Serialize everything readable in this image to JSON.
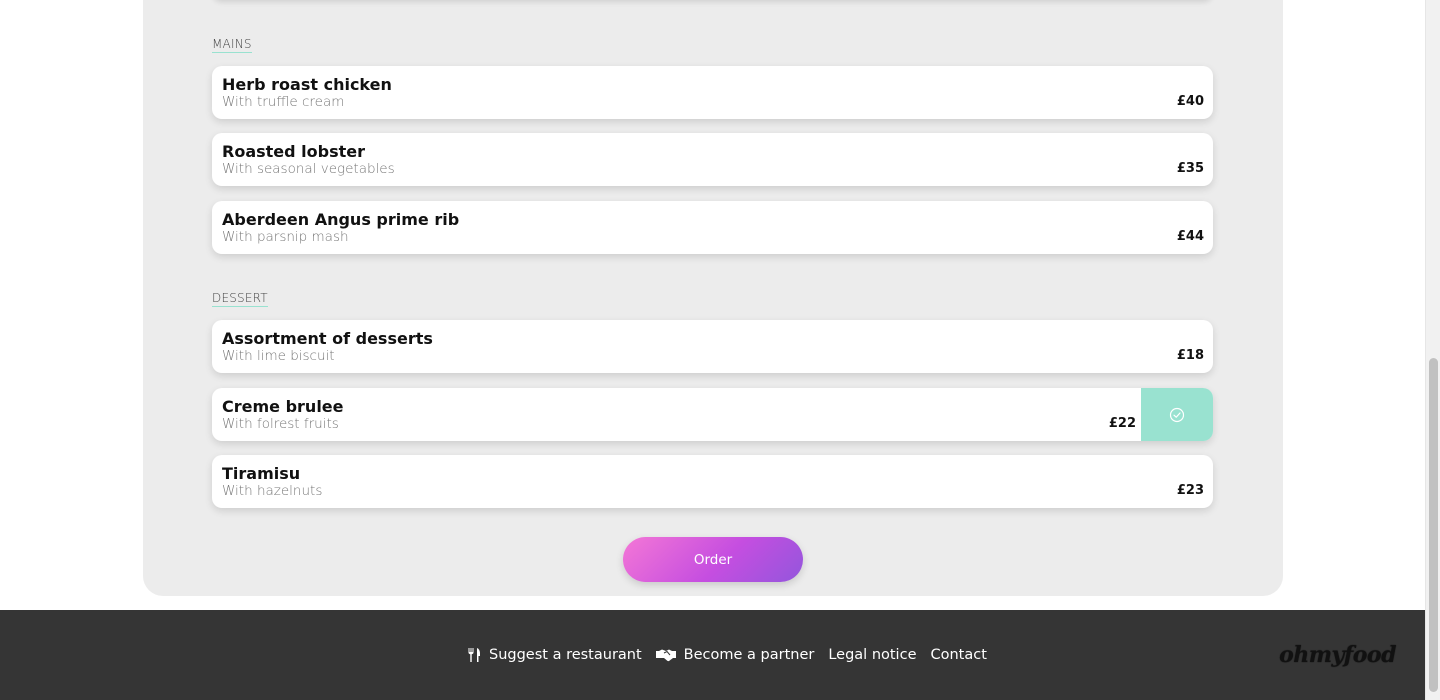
{
  "menu": {
    "sections": [
      {
        "title": "MAINS",
        "dishes": [
          {
            "name": "Herb roast chicken",
            "description": "With truffle cream",
            "price": "£40"
          },
          {
            "name": "Roasted lobster",
            "description": "With seasonal vegetables",
            "price": "£35"
          },
          {
            "name": "Aberdeen Angus prime rib",
            "description": "With parsnip mash",
            "price": "£44"
          }
        ]
      },
      {
        "title": "DESSERT",
        "dishes": [
          {
            "name": "Assortment of desserts",
            "description": "With lime biscuit",
            "price": "£18"
          },
          {
            "name": "Creme brulee",
            "description": "With folrest fruits",
            "price": "£22",
            "selected": true
          },
          {
            "name": "Tiramisu",
            "description": "With hazelnuts",
            "price": "£23"
          }
        ]
      }
    ],
    "order_label": "Order"
  },
  "footer": {
    "links": [
      {
        "label": "Suggest a restaurant",
        "icon": "utensils-icon"
      },
      {
        "label": "Become a partner",
        "icon": "handshake-icon"
      },
      {
        "label": "Legal notice"
      },
      {
        "label": "Contact"
      }
    ],
    "logo": "ohmyfood"
  },
  "colors": {
    "accent": "#99e2d0",
    "panel_bg": "#ececec",
    "footer_bg": "#353535",
    "button_gradient_start": "#f477d6",
    "button_gradient_end": "#9356dc"
  }
}
